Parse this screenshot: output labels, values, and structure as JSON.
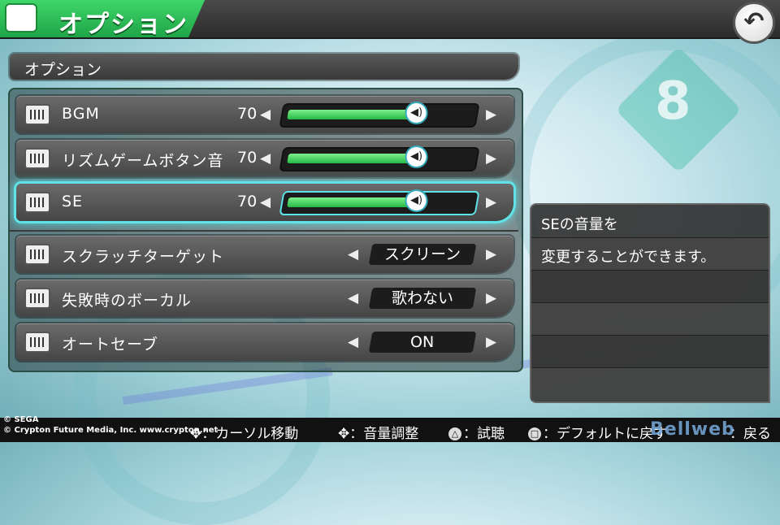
{
  "header": {
    "title": "オプション",
    "back_icon": "↶"
  },
  "section": {
    "title": "オプション"
  },
  "options": [
    {
      "label": "BGM",
      "value": "70",
      "type": "slider",
      "level": 70,
      "selected": false
    },
    {
      "label": "リズムゲームボタン音",
      "value": "70",
      "type": "slider",
      "level": 70,
      "selected": false
    },
    {
      "label": "SE",
      "value": "70",
      "type": "slider",
      "level": 70,
      "selected": true
    },
    {
      "label": "スクラッチターゲット",
      "value": "スクリーン",
      "type": "choice"
    },
    {
      "label": "失敗時のボーカル",
      "value": "歌わない",
      "type": "choice"
    },
    {
      "label": "オートセーブ",
      "value": "ON",
      "type": "choice"
    }
  ],
  "arrows": {
    "left": "◀",
    "right": "▶"
  },
  "description": {
    "line1": "SEの音量を",
    "line2": "変更することができます。"
  },
  "footer": {
    "copyright1": "© SEGA",
    "copyright2": "© Crypton Future Media, Inc. www.crypton.net",
    "hint_cursor": "：カーソル移動",
    "hint_adjust": "：音量調整",
    "hint_test": "：試聴",
    "hint_default": "：デフォルトに戻す",
    "hint_back": "：戻る",
    "triangle_symbol": "△",
    "square_symbol": "□",
    "watermark": "Bellweb"
  },
  "colors": {
    "accent_green": "#1fa447",
    "select_cyan": "#5fe3e8",
    "fill_green": "#26b845"
  }
}
